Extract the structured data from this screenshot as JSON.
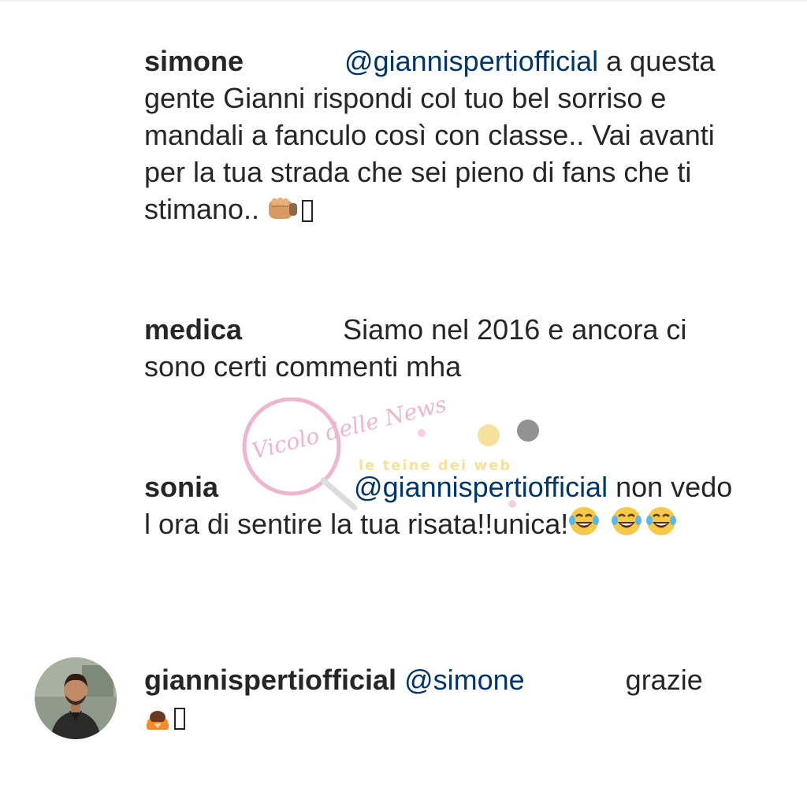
{
  "comments": [
    {
      "username": "simone",
      "mention": "@giannispertiofficial",
      "text_first": "a",
      "text_rest": "questa gente Gianni rispondi col tuo bel sorriso e mandali a fanculo così con classe.. Vai avanti per la tua strada che sei pieno di fans che ti stimano..",
      "emoji": "oncoming-fist-icon"
    },
    {
      "username": "medica",
      "text": "Siamo nel 2016 e ancora ci sono certi commenti mha"
    },
    {
      "username": "sonia",
      "mention": "@giannispertiofficial",
      "text": "non vedo l ora di sentire la tua risata!!unica!",
      "emoji": "tears-of-joy-icon"
    },
    {
      "username": "giannispertiofficial",
      "mention": "@simone",
      "text": "grazie",
      "emoji": "person-bowing-icon"
    }
  ],
  "watermark": {
    "logo_text": "Vicolo delle News",
    "banner_text": "le teine dei web"
  },
  "colors": {
    "text": "#262626",
    "mention": "#003569",
    "watermark_pink": "#e07aa8",
    "watermark_yellow": "#f2c94c"
  }
}
